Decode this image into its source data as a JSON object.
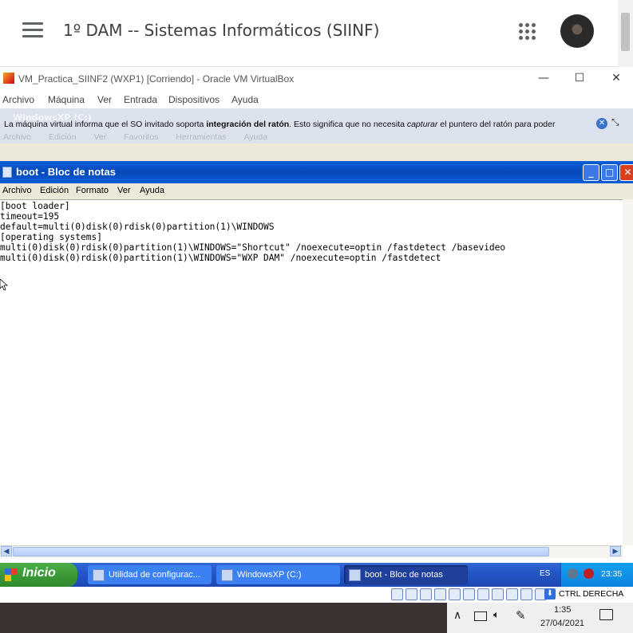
{
  "classroom": {
    "course_title": "1º DAM -- Sistemas Informáticos (SIINF)",
    "menu_icon": "hamburger-icon",
    "apps_icon": "apps-grid-icon",
    "avatar_icon": "user-avatar"
  },
  "vbox": {
    "title": "VM_Practica_SIINF2 (WXP1) [Corriendo] - Oracle VM VirtualBox",
    "window_buttons": {
      "minimize": "—",
      "maximize": "☐",
      "close": "✕"
    },
    "menu": [
      "Archivo",
      "Máquina",
      "Ver",
      "Entrada",
      "Dispositivos",
      "Ayuda"
    ],
    "notification": {
      "part1": "La máquina virtual informa que el SO invitado soporta ",
      "bold": "integración del ratón",
      "part2": ". Esto significa que no necesita ",
      "italic": "capturar",
      "part3": " el puntero del ratón para poder"
    },
    "ghost_title": "WindowsXP (C:)",
    "ghost_menu": [
      "Archivo",
      "Edición",
      "Ver",
      "Favoritos",
      "Herramientas",
      "Ayuda"
    ],
    "status": {
      "host_key": "CTRL DERECHA"
    }
  },
  "notepad": {
    "title": "boot - Bloc de notas",
    "menu": [
      "Archivo",
      "Edición",
      "Formato",
      "Ver",
      "Ayuda"
    ],
    "lines": [
      "[boot loader]",
      "timeout=195",
      "default=multi(0)disk(0)rdisk(0)partition(1)\\WINDOWS",
      "[operating systems]",
      "multi(0)disk(0)rdisk(0)partition(1)\\WINDOWS=\"Shortcut\" /noexecute=optin /fastdetect /basevideo",
      "multi(0)disk(0)rdisk(0)partition(1)\\WINDOWS=\"WXP DAM\" /noexecute=optin /fastdetect"
    ]
  },
  "xp_taskbar": {
    "start": "Inicio",
    "tasks": [
      "Utilidad de configurac...",
      "WindowsXP (C:)",
      "boot - Bloc de notas"
    ],
    "language": "ES",
    "clock": "23:35"
  },
  "win10_taskbar": {
    "time": "1:35",
    "date": "27/04/2021"
  }
}
